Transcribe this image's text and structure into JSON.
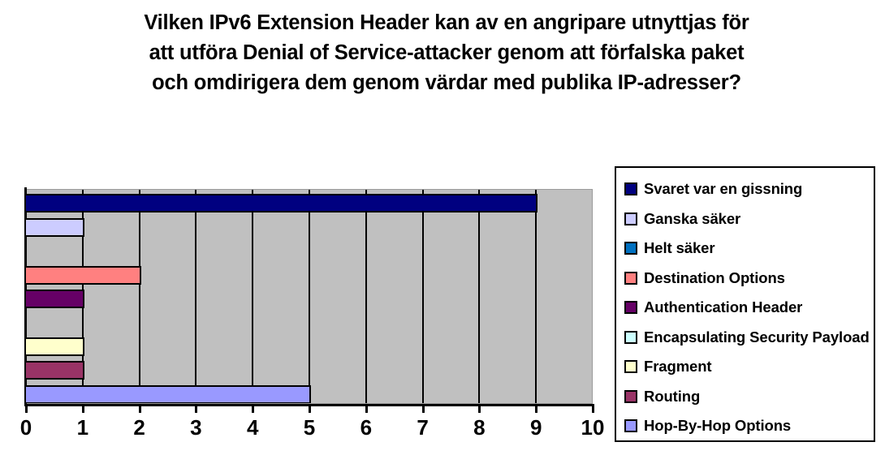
{
  "chart_data": {
    "type": "bar",
    "orientation": "horizontal",
    "title": "Vilken IPv6 Extension Header kan av en angripare utnyttjas för att utföra Denial of Service-attacker genom att förfalska paket och omdirigera dem genom värdar med publika IP-adresser?",
    "title_lines": [
      "Vilken IPv6 Extension Header kan av en angripare utnyttjas för",
      "att utföra Denial of Service-attacker genom att förfalska paket",
      "och omdirigera dem genom värdar med publika IP-adresser?"
    ],
    "xlabel": "",
    "ylabel": "",
    "xlim": [
      0,
      10
    ],
    "xticks": [
      "0",
      "1",
      "2",
      "3",
      "4",
      "5",
      "6",
      "7",
      "8",
      "9",
      "10"
    ],
    "grid": true,
    "grid_axis": "x",
    "legend_position": "right",
    "plot_background": "#c0c0c0",
    "categories": [
      "Svaret var en gissning",
      "Ganska säker",
      "Helt säker",
      " Destination Options",
      "Authentication Header",
      "Encapsulating Security Payload",
      " Fragment",
      "Routing",
      "Hop-By-Hop Options"
    ],
    "values": [
      9,
      1,
      0,
      2,
      1,
      0,
      1,
      1,
      5
    ],
    "colors": [
      "#000080",
      "#ccccff",
      "#0070c0",
      "#ff8080",
      "#660066",
      "#ccffff",
      "#ffffcc",
      "#993366",
      "#9999ff"
    ]
  },
  "legend": {
    "items": [
      {
        "label": "Svaret var en gissning",
        "color": "#000080"
      },
      {
        "label": "Ganska säker",
        "color": "#ccccff"
      },
      {
        "label": "Helt säker",
        "color": "#0070c0"
      },
      {
        "label": " Destination Options",
        "color": "#ff8080"
      },
      {
        "label": "Authentication Header",
        "color": "#660066"
      },
      {
        "label": "Encapsulating Security Payload",
        "color": "#ccffff"
      },
      {
        "label": " Fragment",
        "color": "#ffffcc"
      },
      {
        "label": "Routing",
        "color": "#993366"
      },
      {
        "label": "Hop-By-Hop Options",
        "color": "#9999ff"
      }
    ]
  }
}
